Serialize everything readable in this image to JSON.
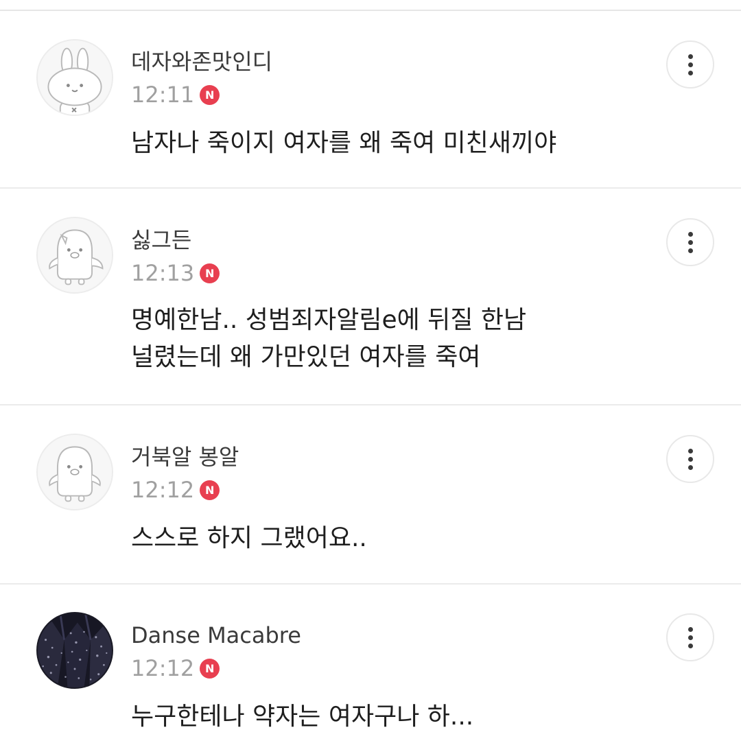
{
  "comments": [
    {
      "author": "데자와존맛인디",
      "time": "12:11",
      "badge": "N",
      "avatar_icon": "rabbit-avatar-icon",
      "text_lines": [
        "남자나 죽이지 여자를 왜 죽여 미친새끼야"
      ]
    },
    {
      "author": "싫그든",
      "time": "12:13",
      "badge": "N",
      "avatar_icon": "penguin-avatar-icon",
      "text_lines": [
        "명예한남.. 성범죄자알림e에 뒤질 한남",
        "널렸는데 왜 가만있던 여자를 죽여"
      ]
    },
    {
      "author": "거북알 봉알",
      "time": "12:12",
      "badge": "N",
      "avatar_icon": "penguin-avatar-icon",
      "text_lines": [
        "스스로 하지 그랬어요.."
      ]
    },
    {
      "author": "Danse Macabre",
      "time": "12:12",
      "badge": "N",
      "avatar_icon": "photo-avatar-icon",
      "text_lines": [
        "누구한테나 약자는 여자구나 하..."
      ]
    }
  ],
  "colors": {
    "badge": "#e83f50",
    "author": "#3a3a3a",
    "time": "#a0a0a0",
    "text": "#1e1e1e",
    "divider": "#ebebeb"
  }
}
